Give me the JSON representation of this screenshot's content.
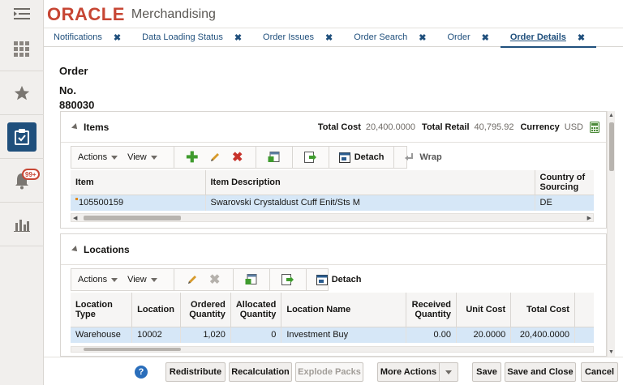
{
  "app": {
    "brand": "ORACLE",
    "product": "Merchandising"
  },
  "rail": {
    "notifications_badge": "99+"
  },
  "tabs": [
    {
      "label": "Notifications"
    },
    {
      "label": "Data Loading Status"
    },
    {
      "label": "Order Issues"
    },
    {
      "label": "Order Search"
    },
    {
      "label": "Order"
    },
    {
      "label": "Order Details"
    }
  ],
  "page": {
    "title_line1": "Order",
    "title_line2": "No.",
    "order_number": "880030"
  },
  "items": {
    "title": "Items",
    "total_cost_label": "Total Cost",
    "total_cost": "20,400.0000",
    "total_retail_label": "Total Retail",
    "total_retail": "40,795.92",
    "currency_label": "Currency",
    "currency": "USD",
    "toolbar": {
      "actions": "Actions",
      "view": "View",
      "detach": "Detach",
      "wrap": "Wrap"
    },
    "columns": [
      "Item",
      "Item Description",
      "Country of Sourcing"
    ],
    "rows": [
      {
        "item": "105500159",
        "description": "Swarovski Crystaldust Cuff Enit/Sts M",
        "country": "DE"
      }
    ]
  },
  "locations": {
    "title": "Locations",
    "toolbar": {
      "actions": "Actions",
      "view": "View",
      "detach": "Detach"
    },
    "columns": [
      "Location Type",
      "Location",
      "Ordered Quantity",
      "Allocated Quantity",
      "Location Name",
      "Received Quantity",
      "Unit Cost",
      "Total Cost"
    ],
    "rows": [
      {
        "type": "Warehouse",
        "location": "10002",
        "ordered": "1,020",
        "allocated": "0",
        "name": "Investment Buy",
        "received": "0.00",
        "unit_cost": "20.0000",
        "total_cost": "20,400.0000"
      }
    ]
  },
  "footer": {
    "redistribute": "Redistribute",
    "recalculation": "Recalculation",
    "explode_packs": "Explode Packs",
    "more_actions": "More Actions",
    "save": "Save",
    "save_close": "Save and Close",
    "cancel": "Cancel",
    "help": "?"
  },
  "colors": {
    "brand_red": "#c74634",
    "nav_blue": "#1f4f7c",
    "selection": "#d6e7f7"
  }
}
